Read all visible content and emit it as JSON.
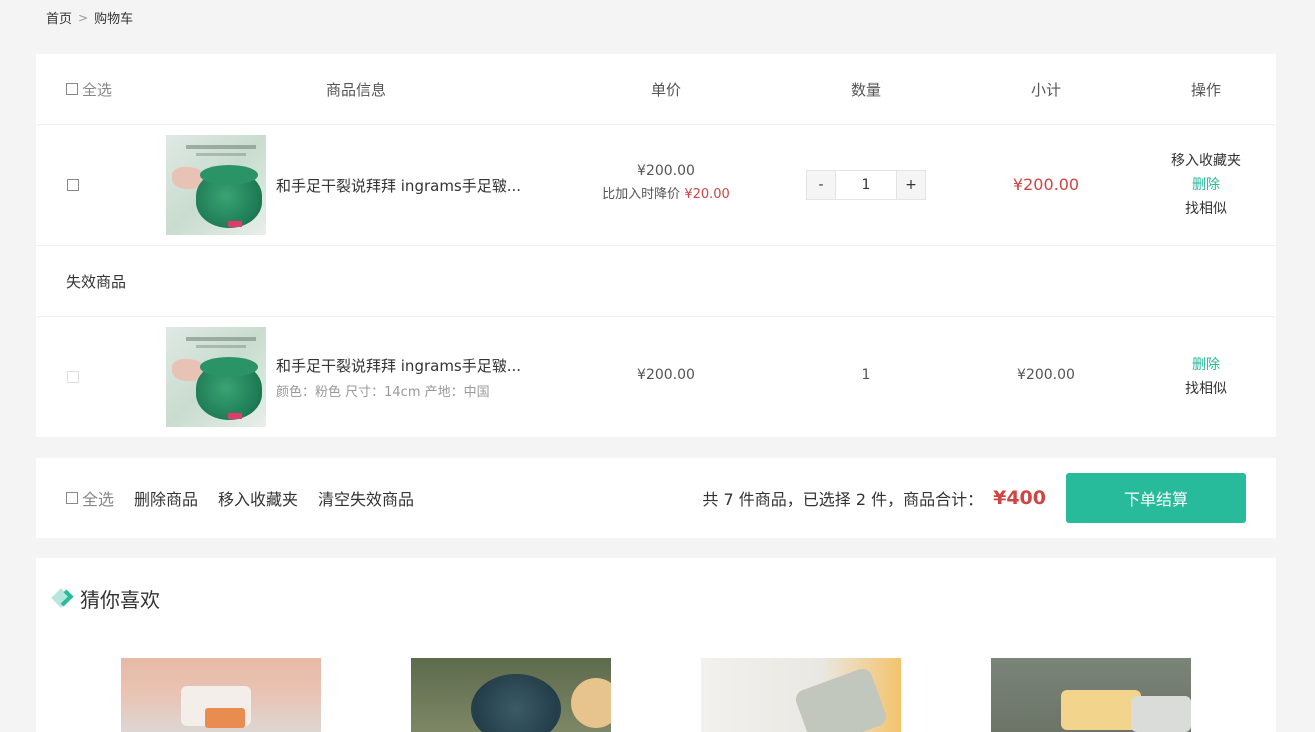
{
  "breadcrumb": {
    "home": "首页",
    "separator": ">",
    "current": "购物车"
  },
  "table_header": {
    "select_all": "全选",
    "product_info": "商品信息",
    "unit_price": "单价",
    "quantity": "数量",
    "subtotal": "小计",
    "actions": "操作"
  },
  "items": [
    {
      "name": "和手足干裂说拜拜 ingrams手足皲...",
      "price": "¥200.00",
      "price_drop_label": "比加入时降价",
      "price_drop_value": "¥20.00",
      "quantity": "1",
      "minus": "-",
      "plus": "+",
      "subtotal": "¥200.00",
      "action_favorite": "移入收藏夹",
      "action_delete": "删除",
      "action_similar": "找相似"
    }
  ],
  "invalid_section": {
    "title": "失效商品",
    "items": [
      {
        "name": "和手足干裂说拜拜 ingrams手足皲...",
        "attrs": "颜色：粉色 尺寸：14cm 产地：中国",
        "price": "¥200.00",
        "quantity": "1",
        "subtotal": "¥200.00",
        "action_delete": "删除",
        "action_similar": "找相似"
      }
    ]
  },
  "footer": {
    "select_all": "全选",
    "delete_products": "删除商品",
    "move_to_favorites": "移入收藏夹",
    "clear_invalid": "清空失效商品",
    "summary": "共 7 件商品，已选择 2 件，商品合计：",
    "total": "¥400",
    "checkout": "下单结算"
  },
  "recommend": {
    "title": "猜你喜欢"
  },
  "colors": {
    "accent": "#27ba9b",
    "price_red": "#cf4444",
    "background": "#f4f4f4"
  }
}
